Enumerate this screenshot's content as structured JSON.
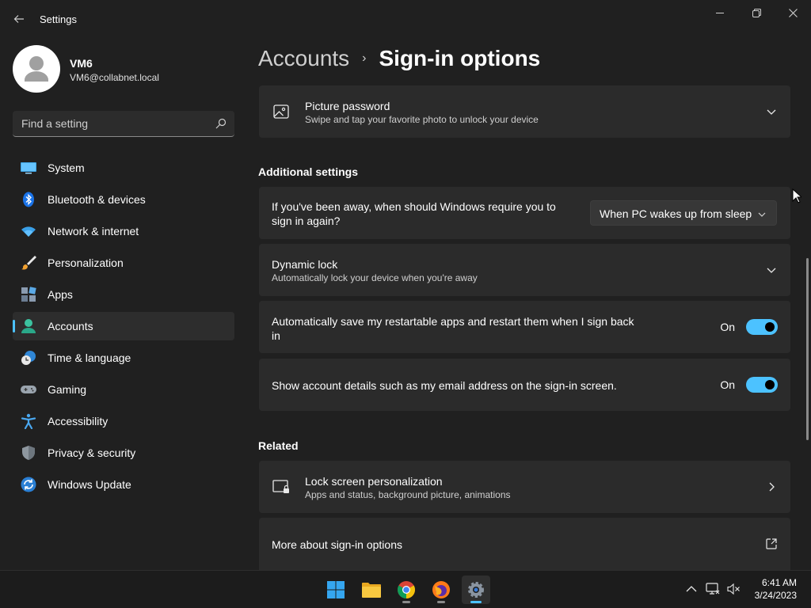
{
  "window": {
    "title": "Settings",
    "back_icon": "arrow-left-icon",
    "controls": [
      "minimize-icon",
      "restore-icon",
      "close-icon"
    ]
  },
  "profile": {
    "name": "VM6",
    "email": "VM6@collabnet.local"
  },
  "search": {
    "placeholder": "Find a setting",
    "icon": "search-icon"
  },
  "sidebar": {
    "items": [
      {
        "label": "System",
        "icon": "system-icon"
      },
      {
        "label": "Bluetooth & devices",
        "icon": "bluetooth-icon"
      },
      {
        "label": "Network & internet",
        "icon": "wifi-icon"
      },
      {
        "label": "Personalization",
        "icon": "brush-icon"
      },
      {
        "label": "Apps",
        "icon": "apps-icon"
      },
      {
        "label": "Accounts",
        "icon": "accounts-icon",
        "active": true
      },
      {
        "label": "Time & language",
        "icon": "clock-globe-icon"
      },
      {
        "label": "Gaming",
        "icon": "gamepad-icon"
      },
      {
        "label": "Accessibility",
        "icon": "accessibility-icon"
      },
      {
        "label": "Privacy & security",
        "icon": "shield-icon"
      },
      {
        "label": "Windows Update",
        "icon": "update-icon"
      }
    ]
  },
  "breadcrumb": {
    "parent": "Accounts",
    "separator": "›",
    "current": "Sign-in options"
  },
  "picture_password": {
    "title": "Picture password",
    "subtitle": "Swipe and tap your favorite photo to unlock your device",
    "icon": "picture-icon"
  },
  "additional_settings": {
    "heading": "Additional settings",
    "require_signin": {
      "line1": "If you've been away, when should Windows require you to",
      "line2": "sign in again?",
      "dropdown_value": "When PC wakes up from sleep"
    },
    "dynamic_lock": {
      "title": "Dynamic lock",
      "subtitle": "Automatically lock your device when you're away"
    },
    "restart_apps": {
      "line1": "Automatically save my restartable apps and restart them when I sign back",
      "line2": "in",
      "state": "On"
    },
    "account_details": {
      "title": "Show account details such as my email address on the sign-in screen.",
      "state": "On"
    }
  },
  "related": {
    "heading": "Related",
    "lock_screen": {
      "title": "Lock screen personalization",
      "subtitle": "Apps and status, background picture, animations",
      "icon": "lock-screen-icon"
    },
    "more_about": {
      "title": "More about sign-in options",
      "icon": "external-link-icon"
    }
  },
  "taskbar": {
    "apps": [
      "windows-start-icon",
      "file-explorer-icon",
      "chrome-icon",
      "firefox-icon",
      "settings-gear-icon"
    ],
    "tray": [
      "chevron-up-icon",
      "network-icon",
      "volume-muted-icon"
    ],
    "time": "6:41 AM",
    "date": "3/24/2023"
  },
  "colors": {
    "accent": "#4cc2ff",
    "background": "#202020",
    "card": "#2b2b2b"
  }
}
